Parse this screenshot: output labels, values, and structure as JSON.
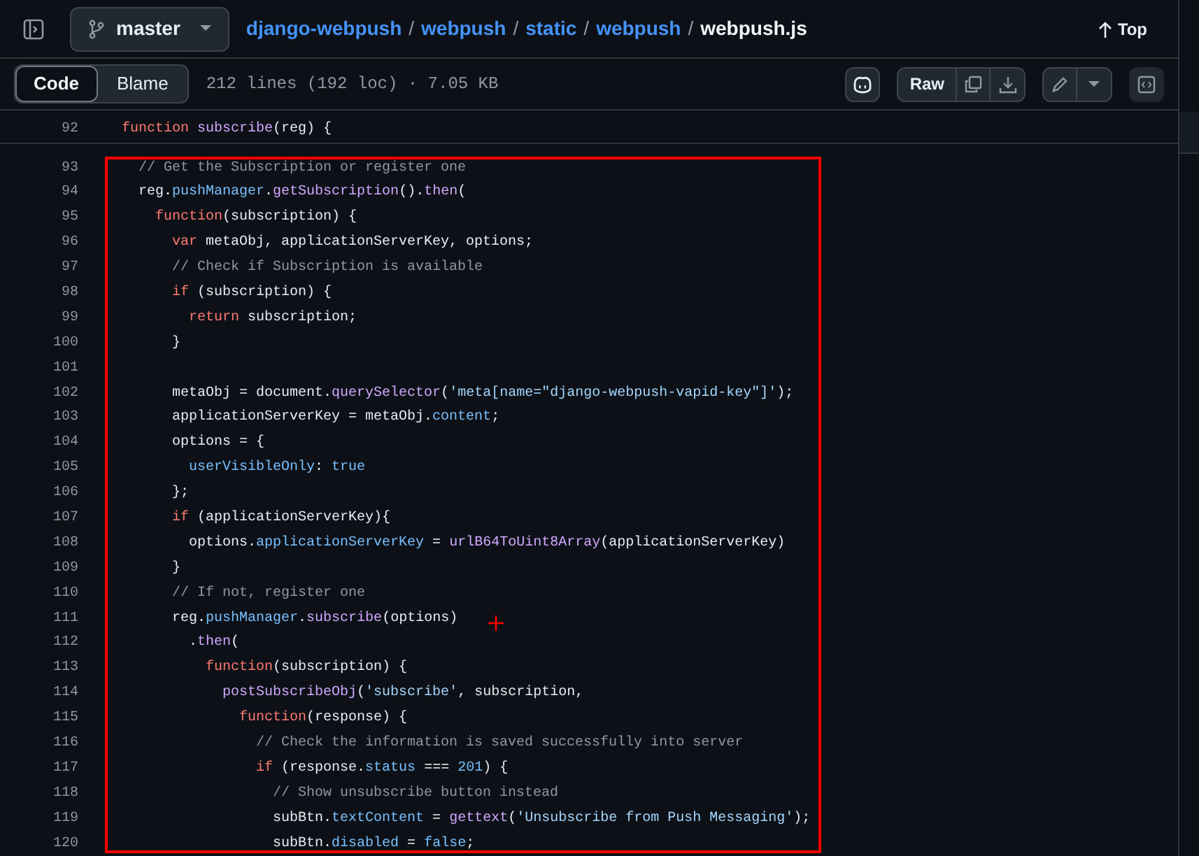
{
  "header": {
    "branch": "master",
    "breadcrumb": [
      {
        "kind": "link",
        "text": "django-webpush"
      },
      {
        "kind": "sep",
        "text": "/"
      },
      {
        "kind": "link",
        "text": "webpush"
      },
      {
        "kind": "sep",
        "text": "/"
      },
      {
        "kind": "link",
        "text": "static"
      },
      {
        "kind": "sep",
        "text": "/"
      },
      {
        "kind": "link",
        "text": "webpush"
      },
      {
        "kind": "sep",
        "text": "/"
      },
      {
        "kind": "current",
        "text": "webpush.js"
      }
    ],
    "top_button": "Top"
  },
  "toolbar": {
    "tabs": [
      {
        "label": "Code",
        "selected": true
      },
      {
        "label": "Blame",
        "selected": false
      }
    ],
    "file_info": "212 lines (192 loc) · 7.05 KB",
    "raw_button": "Raw"
  },
  "sticky_line": {
    "number": "92",
    "tokens": [
      {
        "kind": "kw",
        "text": "function"
      },
      {
        "kind": "func",
        "text": " subscribe"
      },
      {
        "kind": "plain",
        "text": "(reg) {"
      }
    ]
  },
  "lines": [
    {
      "number": "93",
      "tokens": [
        {
          "kind": "comment",
          "text": "  // Get the Subscription or register one"
        }
      ]
    },
    {
      "number": "94",
      "tokens": [
        {
          "kind": "plain",
          "text": "  reg."
        },
        {
          "kind": "prop",
          "text": "pushManager"
        },
        {
          "kind": "plain",
          "text": "."
        },
        {
          "kind": "func",
          "text": "getSubscription"
        },
        {
          "kind": "plain",
          "text": "()."
        },
        {
          "kind": "func",
          "text": "then"
        },
        {
          "kind": "plain",
          "text": "("
        }
      ]
    },
    {
      "number": "95",
      "tokens": [
        {
          "kind": "kw",
          "text": "    function"
        },
        {
          "kind": "plain",
          "text": "(subscription) {"
        }
      ]
    },
    {
      "number": "96",
      "tokens": [
        {
          "kind": "kw",
          "text": "      var"
        },
        {
          "kind": "plain",
          "text": " metaObj, applicationServerKey, options;"
        }
      ]
    },
    {
      "number": "97",
      "tokens": [
        {
          "kind": "comment",
          "text": "      // Check if Subscription is available"
        }
      ]
    },
    {
      "number": "98",
      "tokens": [
        {
          "kind": "kw",
          "text": "      if"
        },
        {
          "kind": "plain",
          "text": " (subscription) {"
        }
      ]
    },
    {
      "number": "99",
      "tokens": [
        {
          "kind": "kw",
          "text": "        return"
        },
        {
          "kind": "plain",
          "text": " subscription;"
        }
      ]
    },
    {
      "number": "100",
      "tokens": [
        {
          "kind": "plain",
          "text": "      }"
        }
      ]
    },
    {
      "number": "101"
    },
    {
      "number": "102",
      "tokens": [
        {
          "kind": "plain",
          "text": "      metaObj = document."
        },
        {
          "kind": "func",
          "text": "querySelector"
        },
        {
          "kind": "plain",
          "text": "("
        },
        {
          "kind": "string",
          "text": "'meta[name=\"django-webpush-vapid-key\"]'"
        },
        {
          "kind": "plain",
          "text": ");"
        }
      ]
    },
    {
      "number": "103",
      "tokens": [
        {
          "kind": "plain",
          "text": "      applicationServerKey = metaObj."
        },
        {
          "kind": "prop",
          "text": "content"
        },
        {
          "kind": "plain",
          "text": ";"
        }
      ]
    },
    {
      "number": "104",
      "tokens": [
        {
          "kind": "plain",
          "text": "      options = {"
        }
      ]
    },
    {
      "number": "105",
      "tokens": [
        {
          "kind": "prop",
          "text": "        userVisibleOnly"
        },
        {
          "kind": "plain",
          "text": ": "
        },
        {
          "kind": "const",
          "text": "true"
        }
      ]
    },
    {
      "number": "106",
      "tokens": [
        {
          "kind": "plain",
          "text": "      };"
        }
      ]
    },
    {
      "number": "107",
      "tokens": [
        {
          "kind": "kw",
          "text": "      if"
        },
        {
          "kind": "plain",
          "text": " (applicationServerKey){"
        }
      ]
    },
    {
      "number": "108",
      "tokens": [
        {
          "kind": "plain",
          "text": "        options."
        },
        {
          "kind": "prop",
          "text": "applicationServerKey"
        },
        {
          "kind": "plain",
          "text": " = "
        },
        {
          "kind": "func",
          "text": "urlB64ToUint8Array"
        },
        {
          "kind": "plain",
          "text": "(applicationServerKey)"
        }
      ]
    },
    {
      "number": "109",
      "tokens": [
        {
          "kind": "plain",
          "text": "      }"
        }
      ]
    },
    {
      "number": "110",
      "tokens": [
        {
          "kind": "comment",
          "text": "      // If not, register one"
        }
      ]
    },
    {
      "number": "111",
      "tokens": [
        {
          "kind": "plain",
          "text": "      reg."
        },
        {
          "kind": "prop",
          "text": "pushManager"
        },
        {
          "kind": "plain",
          "text": "."
        },
        {
          "kind": "func",
          "text": "subscribe"
        },
        {
          "kind": "plain",
          "text": "(options)"
        }
      ]
    },
    {
      "number": "112",
      "tokens": [
        {
          "kind": "plain",
          "text": "        ."
        },
        {
          "kind": "func",
          "text": "then"
        },
        {
          "kind": "plain",
          "text": "("
        }
      ]
    },
    {
      "number": "113",
      "tokens": [
        {
          "kind": "kw",
          "text": "          function"
        },
        {
          "kind": "plain",
          "text": "(subscription) {"
        }
      ]
    },
    {
      "number": "114",
      "tokens": [
        {
          "kind": "func",
          "text": "            postSubscribeObj"
        },
        {
          "kind": "plain",
          "text": "("
        },
        {
          "kind": "string",
          "text": "'subscribe'"
        },
        {
          "kind": "plain",
          "text": ", subscription,"
        }
      ]
    },
    {
      "number": "115",
      "tokens": [
        {
          "kind": "kw",
          "text": "              function"
        },
        {
          "kind": "plain",
          "text": "(response) {"
        }
      ]
    },
    {
      "number": "116",
      "tokens": [
        {
          "kind": "comment",
          "text": "                // Check the information is saved successfully into server"
        }
      ]
    },
    {
      "number": "117",
      "tokens": [
        {
          "kind": "kw",
          "text": "                if"
        },
        {
          "kind": "plain",
          "text": " (response."
        },
        {
          "kind": "prop",
          "text": "status"
        },
        {
          "kind": "plain",
          "text": " === "
        },
        {
          "kind": "const",
          "text": "201"
        },
        {
          "kind": "plain",
          "text": ") {"
        }
      ]
    },
    {
      "number": "118",
      "tokens": [
        {
          "kind": "comment",
          "text": "                  // Show unsubscribe button instead"
        }
      ]
    },
    {
      "number": "119",
      "tokens": [
        {
          "kind": "plain",
          "text": "                  subBtn."
        },
        {
          "kind": "prop",
          "text": "textContent"
        },
        {
          "kind": "plain",
          "text": " = "
        },
        {
          "kind": "func",
          "text": "gettext"
        },
        {
          "kind": "plain",
          "text": "("
        },
        {
          "kind": "string",
          "text": "'Unsubscribe from Push Messaging'"
        },
        {
          "kind": "plain",
          "text": ");"
        }
      ]
    },
    {
      "number": "120",
      "tokens": [
        {
          "kind": "plain",
          "text": "                  subBtn."
        },
        {
          "kind": "prop",
          "text": "disabled"
        },
        {
          "kind": "plain",
          "text": " = "
        },
        {
          "kind": "const",
          "text": "false"
        },
        {
          "kind": "plain",
          "text": ";"
        }
      ]
    }
  ]
}
